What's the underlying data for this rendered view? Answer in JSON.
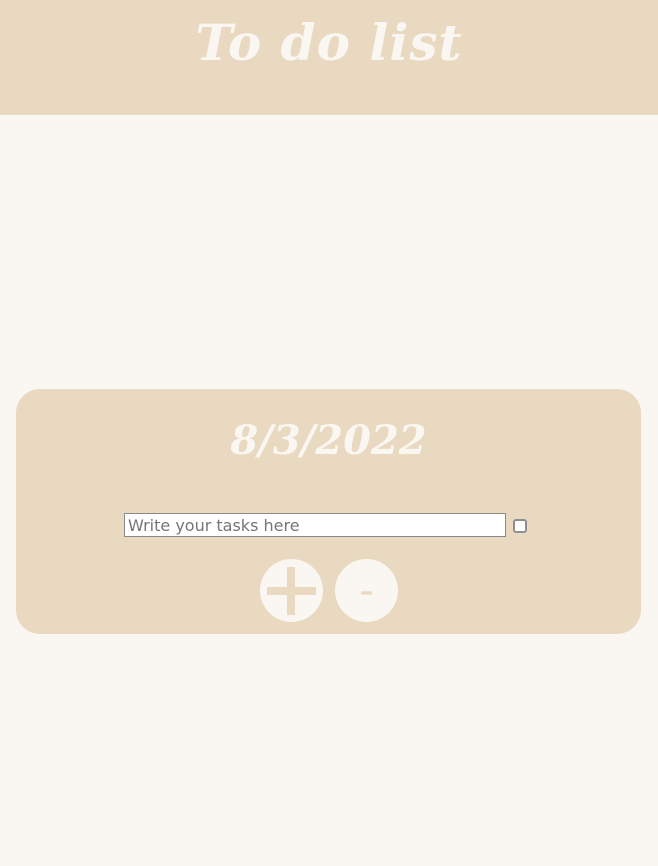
{
  "header": {
    "title": "To do list"
  },
  "card": {
    "date": "8/3/2022",
    "task_input": {
      "value": "",
      "placeholder": "Write your tasks here"
    },
    "task_checkbox": {
      "checked": false
    },
    "add_button": {
      "icon": "plus-icon"
    },
    "remove_button": {
      "label": "-"
    }
  },
  "colors": {
    "background": "#faf7f2",
    "accent": "#e9d9c1"
  }
}
